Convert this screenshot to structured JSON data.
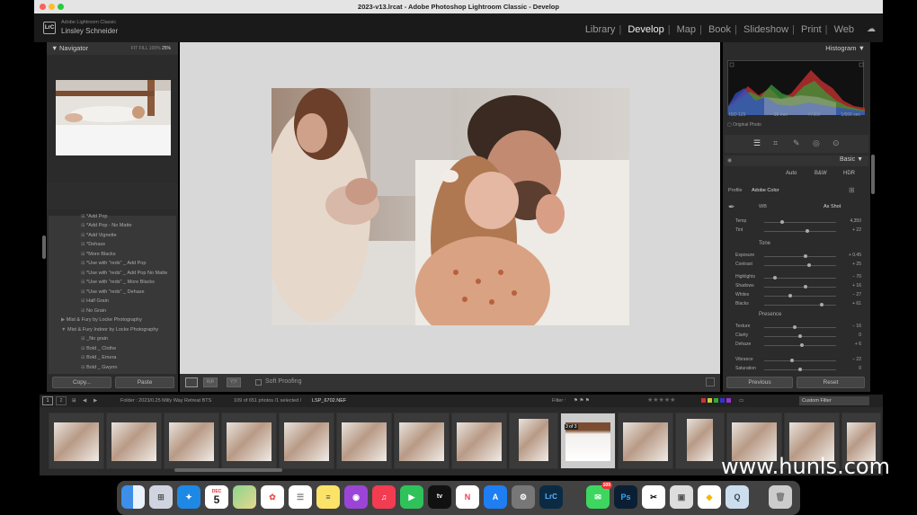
{
  "window": {
    "title": "2023-v13.lrcat - Adobe Photoshop Lightroom Classic - Develop"
  },
  "header": {
    "catalog": "Adobe Lightroom Classic",
    "user": "Linsley Schneider",
    "logo": "LrC",
    "modules": [
      "Library",
      "Develop",
      "Map",
      "Book",
      "Slideshow",
      "Print",
      "Web"
    ],
    "active": "Develop"
  },
  "navigator": {
    "title": "Navigator",
    "zooms": [
      "FIT",
      "FILL",
      "100%",
      "25%"
    ]
  },
  "presets": [
    "*Add Pop",
    "*Add Pop - No Matte",
    "*Add Vignette",
    "*Dehaze",
    "*More Blacks",
    "*Use with \"reds\" _ Add Pop",
    "*Use with \"reds\" _ Add Pop No Matte",
    "*Use with \"reds\" _ More Blacks",
    "*Use with \"reds\" _ Dehaze",
    "Half Grain",
    "No Grain"
  ],
  "preset_folders": [
    "Mist & Fury by Locke Photography",
    "Mist & Fury Indoor by Locke Photography"
  ],
  "preset_sub": [
    "_No grain",
    "Bold _ Clothe",
    "Bold _ Emera",
    "Bold _ Gwynn"
  ],
  "left_buttons": {
    "copy": "Copy...",
    "paste": "Paste"
  },
  "toolbar": {
    "soft_proofing": "Soft Proofing"
  },
  "histogram": {
    "title": "Histogram",
    "iso": "ISO 125",
    "focal": "35 mm",
    "aperture": "f / 2.0",
    "shutter": "1/500 sec",
    "original": "Original Photo"
  },
  "basic": {
    "title": "Basic",
    "modes": [
      "Auto",
      "B&W",
      "HDR"
    ],
    "profile_label": "Profile",
    "profile": "Adobe Color",
    "wb_label": "WB",
    "wb": "As Shot",
    "tone_label": "Tone",
    "presence_label": "Presence",
    "sliders": [
      {
        "name": "Temp",
        "value": "4,350",
        "pos": 0.25
      },
      {
        "name": "Tint",
        "value": "+ 22",
        "pos": 0.6
      },
      {
        "name": "Exposure",
        "value": "+ 0.45",
        "pos": 0.58
      },
      {
        "name": "Contrast",
        "value": "+ 25",
        "pos": 0.62
      },
      {
        "name": "Highlights",
        "value": "− 70",
        "pos": 0.15
      },
      {
        "name": "Shadows",
        "value": "+ 16",
        "pos": 0.58
      },
      {
        "name": "Whites",
        "value": "− 27",
        "pos": 0.36
      },
      {
        "name": "Blacks",
        "value": "+ 61",
        "pos": 0.8
      },
      {
        "name": "Texture",
        "value": "− 16",
        "pos": 0.42
      },
      {
        "name": "Clarity",
        "value": "0",
        "pos": 0.5
      },
      {
        "name": "Dehaze",
        "value": "+ 6",
        "pos": 0.53
      },
      {
        "name": "Vibrance",
        "value": "− 22",
        "pos": 0.39
      },
      {
        "name": "Saturation",
        "value": "0",
        "pos": 0.5
      }
    ]
  },
  "right_buttons": {
    "previous": "Previous",
    "reset": "Reset"
  },
  "filmstrip": {
    "pages": [
      "1",
      "2"
    ],
    "folder": "Folder : 2023/0.25 Milly Way Retreat BTS",
    "count": "109 of 651 photos /1 selected /",
    "file": "LSP_6702.NEF",
    "filter_label": "Filter :",
    "filter_value": "Custom Filter",
    "selected_badge": "3 of 3"
  },
  "dock": {
    "apps": [
      "Finder",
      "Launchpad",
      "Safari",
      "Calendar",
      "Maps",
      "Photos",
      "Reminders",
      "Notes",
      "Podcasts",
      "Music",
      "FaceTime",
      "TV",
      "News",
      "App Store",
      "System Settings",
      "Lightroom Classic",
      "Messages",
      "Photoshop",
      "CapCut",
      "Preview",
      "Norton",
      "QuickTime",
      "Trash"
    ],
    "calendar_day": "5",
    "calendar_month": "DEC",
    "messages_badge": "109"
  },
  "watermark": "www.hunls.com"
}
